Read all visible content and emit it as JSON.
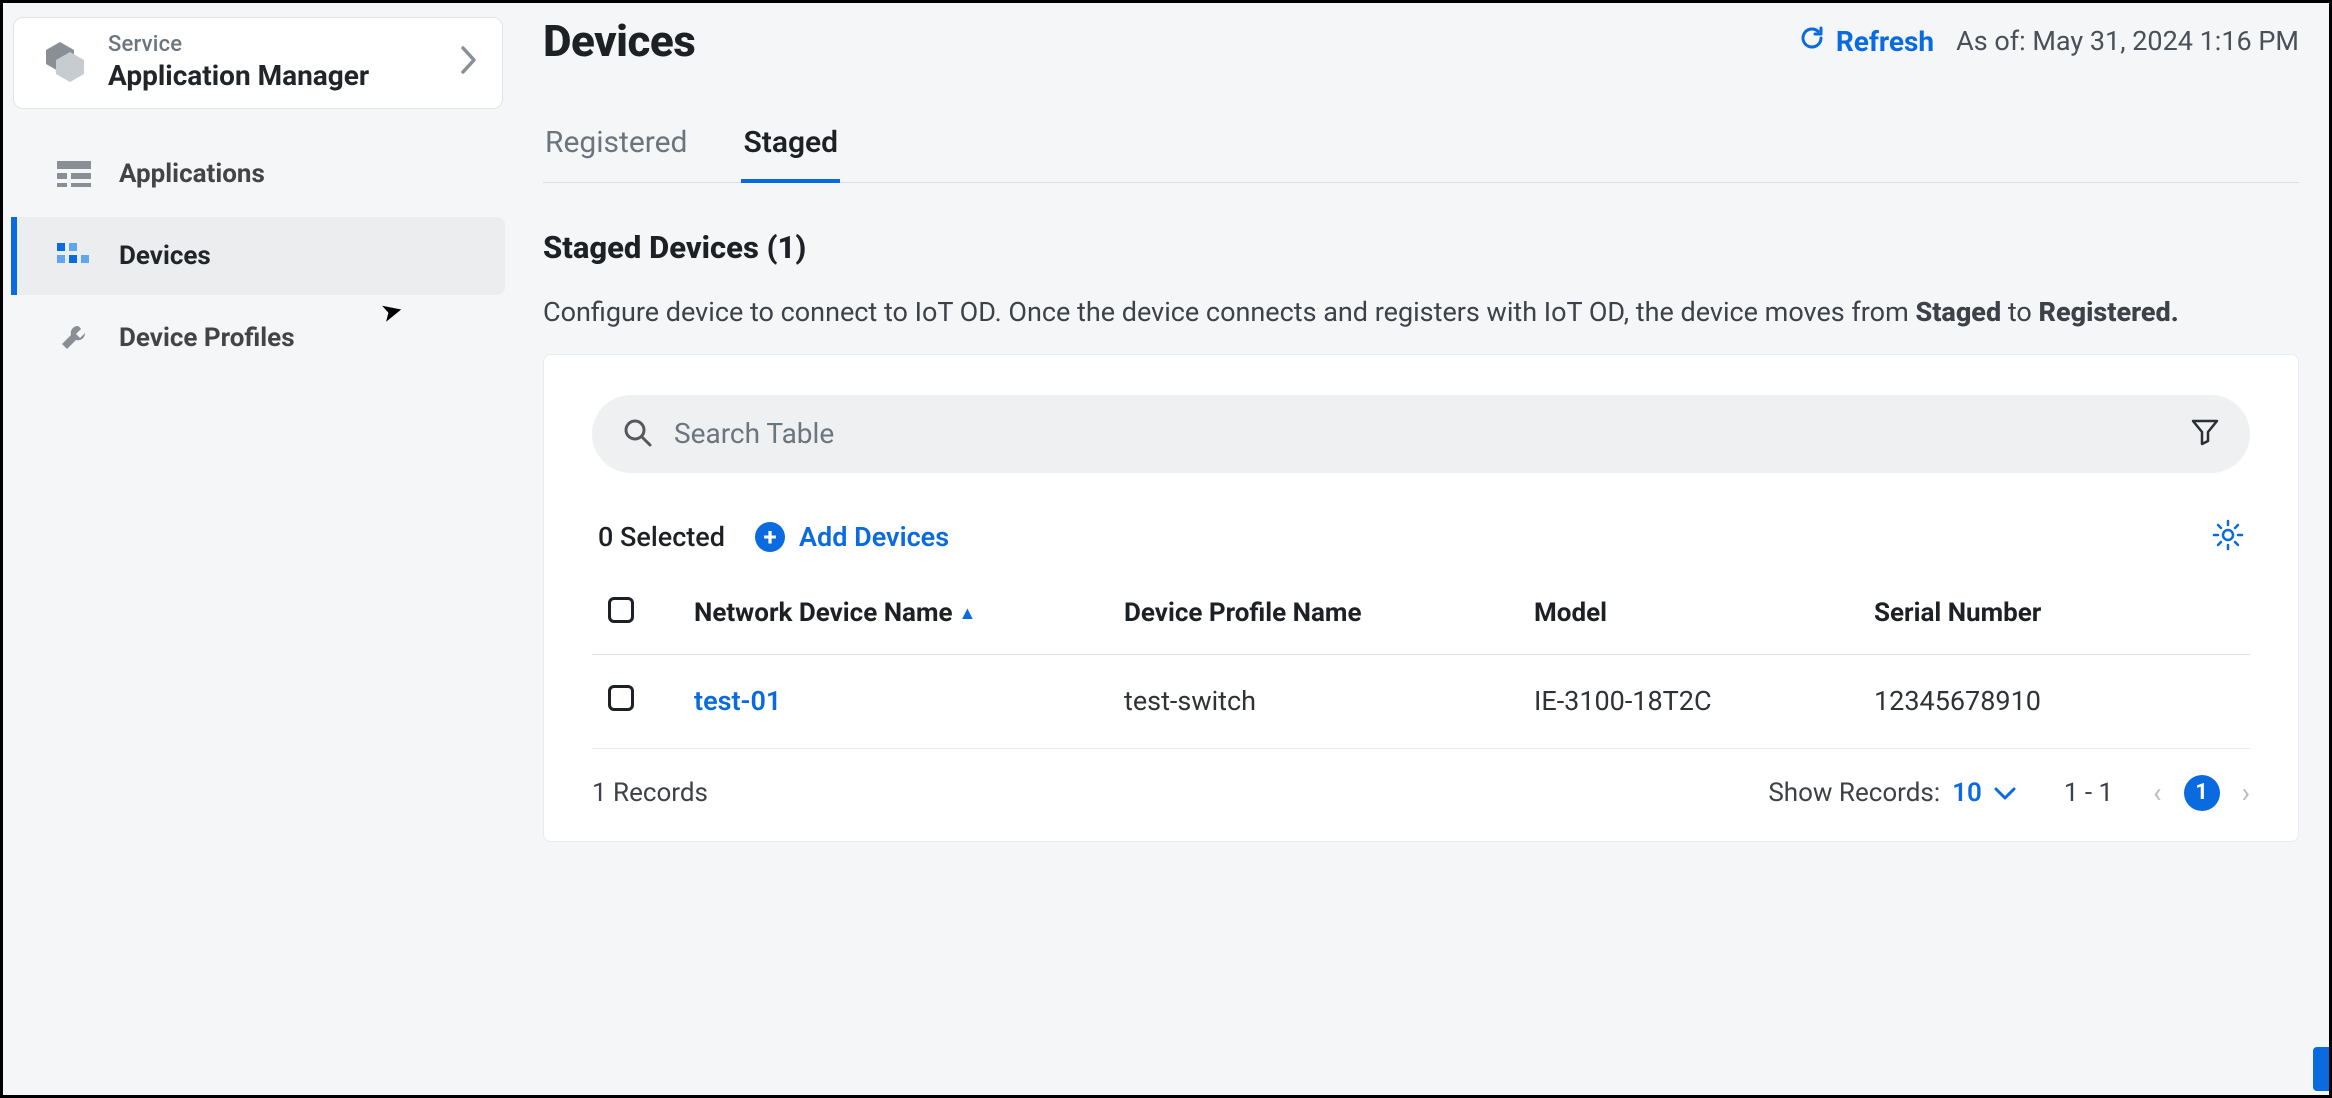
{
  "sidebar": {
    "service_label": "Service",
    "service_name": "Application Manager",
    "items": [
      {
        "label": "Applications"
      },
      {
        "label": "Devices"
      },
      {
        "label": "Device Profiles"
      }
    ]
  },
  "header": {
    "title": "Devices",
    "refresh_label": "Refresh",
    "asof": "As of: May 31, 2024 1:16 PM"
  },
  "tabs": {
    "registered": "Registered",
    "staged": "Staged"
  },
  "section": {
    "title": "Staged Devices (1)",
    "desc_pre": "Configure device to connect to IoT OD. Once the device connects and registers with IoT OD, the device moves from ",
    "desc_bold1": "Staged",
    "desc_mid": " to ",
    "desc_bold2": "Registered."
  },
  "search": {
    "placeholder": "Search Table"
  },
  "toolbar": {
    "selected": "0 Selected",
    "add_devices": "Add Devices"
  },
  "table": {
    "headers": {
      "name": "Network Device Name",
      "profile": "Device Profile Name",
      "model": "Model",
      "serial": "Serial Number"
    },
    "rows": [
      {
        "name": "test-01",
        "profile": "test-switch",
        "model": "IE-3100-18T2C",
        "serial": "12345678910"
      }
    ]
  },
  "footer": {
    "records": "1 Records",
    "show_records_label": "Show Records:",
    "page_size": "10",
    "range": "1 - 1",
    "current_page": "1"
  }
}
